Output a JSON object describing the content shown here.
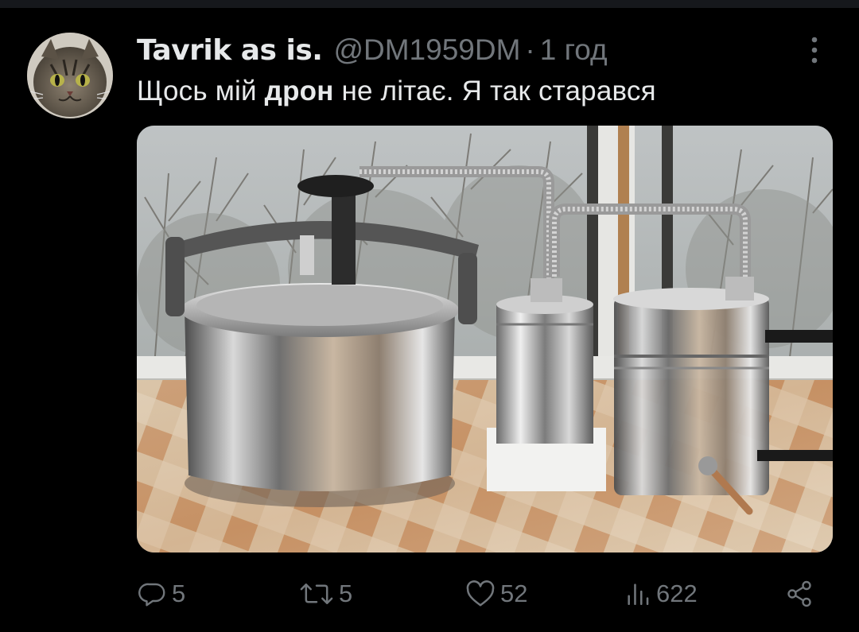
{
  "tweet": {
    "author": {
      "display_name": "Tavrik as is.",
      "handle": "@DM1959DM",
      "separator": "·",
      "time": "1 год",
      "avatar_icon": "cat-avatar"
    },
    "text_before": "Щось мій ",
    "text_bold": "дрон",
    "text_after": " не літає. Я так старався",
    "more_icon": "more-vertical-icon",
    "media": {
      "description_icon": "photo"
    },
    "actions": {
      "replies": "5",
      "retweets": "5",
      "likes": "52",
      "views": "622"
    }
  },
  "colors": {
    "background": "#000000",
    "text_primary": "#e7e9ea",
    "text_secondary": "#71767b"
  }
}
